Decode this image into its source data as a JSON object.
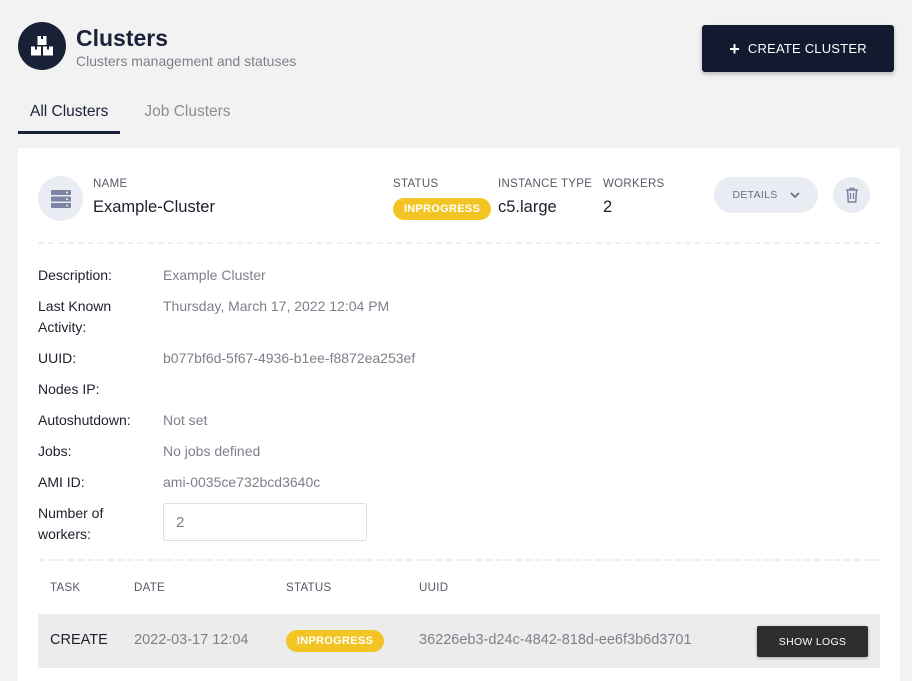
{
  "header": {
    "title": "Clusters",
    "subtitle": "Clusters management and statuses",
    "create_label": "CREATE CLUSTER"
  },
  "tabs": [
    {
      "label": "All Clusters",
      "active": true
    },
    {
      "label": "Job Clusters",
      "active": false
    }
  ],
  "cluster": {
    "name_label": "NAME",
    "name": "Example-Cluster",
    "status_label": "STATUS",
    "status": "INPROGRESS",
    "instance_type_label": "INSTANCE TYPE",
    "instance_type": "c5.large",
    "workers_label": "WORKERS",
    "workers": "2",
    "details_label": "DETAILS",
    "details": [
      {
        "label": "Description:",
        "value": "Example Cluster"
      },
      {
        "label": "Last Known Activity:",
        "value": "Thursday, March 17, 2022 12:04 PM"
      },
      {
        "label": "UUID:",
        "value": "b077bf6d-5f67-4936-b1ee-f8872ea253ef"
      },
      {
        "label": "Nodes IP:",
        "value": ""
      },
      {
        "label": "Autoshutdown:",
        "value": "Not set"
      },
      {
        "label": "Jobs:",
        "value": "No jobs defined"
      },
      {
        "label": "AMI ID:",
        "value": "ami-0035ce732bcd3640c"
      },
      {
        "label": "Number of workers:",
        "value": "2"
      }
    ]
  },
  "tasks": {
    "columns": [
      "TASK",
      "DATE",
      "STATUS",
      "UUID"
    ],
    "rows": [
      {
        "task": "CREATE",
        "date": "2022-03-17 12:04",
        "status": "INPROGRESS",
        "uuid": "36226eb3-d24c-4842-818d-ee6f3b6d3701",
        "action_label": "SHOW LOGS"
      }
    ]
  },
  "colors": {
    "primary": "#111a2e",
    "badge": "#f2c525",
    "background": "#f2f2f2"
  },
  "icons": {
    "logo": "boxes-icon",
    "cluster": "server-icon",
    "details": "chevron-down-icon",
    "delete": "trash-icon",
    "create": "plus-icon"
  }
}
